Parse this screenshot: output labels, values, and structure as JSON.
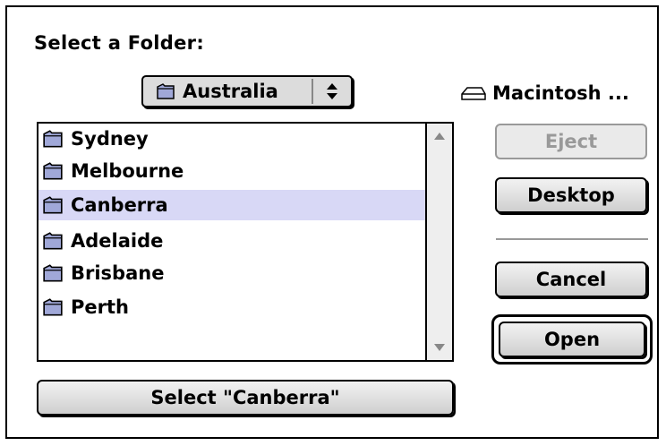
{
  "dialog": {
    "title": "Select a Folder:",
    "location_popup": {
      "selected": "Australia",
      "icon": "folder-icon"
    },
    "volume": {
      "name": "Macintosh ...",
      "icon": "disk-icon"
    },
    "folders": [
      {
        "name": "Sydney",
        "selected": false
      },
      {
        "name": "Melbourne",
        "selected": false
      },
      {
        "name": "Canberra",
        "selected": true
      },
      {
        "name": "Adelaide",
        "selected": false
      },
      {
        "name": "Brisbane",
        "selected": false
      },
      {
        "name": "Perth",
        "selected": false
      }
    ],
    "buttons": {
      "eject": "Eject",
      "desktop": "Desktop",
      "cancel": "Cancel",
      "open": "Open",
      "select": "Select \"Canberra\""
    },
    "colors": {
      "selection": "#d8d8f6",
      "button_face": "#dcdcdc"
    }
  }
}
